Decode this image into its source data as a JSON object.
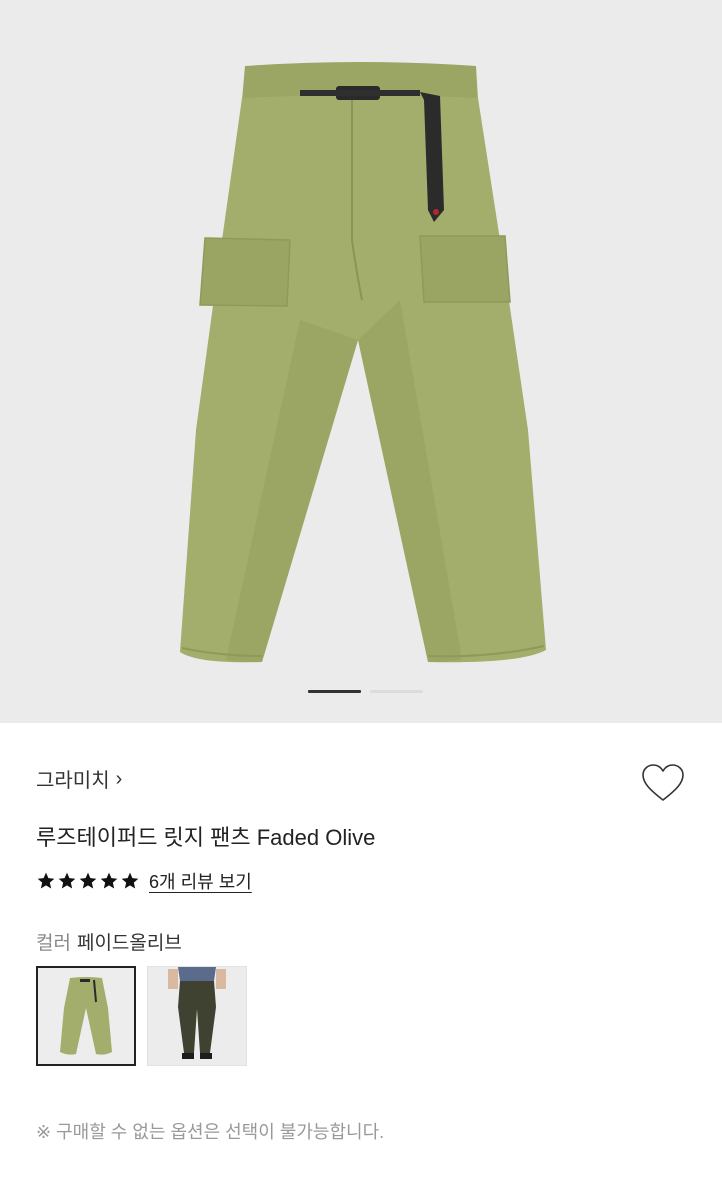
{
  "gallery": {
    "main_image": "pants-faded-olive-photo",
    "current_slide": 1,
    "total_slides": 2
  },
  "brand": {
    "name": "그라미치",
    "arrow": "›"
  },
  "wishlist": {
    "icon": "heart-outline-icon"
  },
  "product": {
    "title": "루즈테이퍼드 릿지 팬츠 Faded Olive"
  },
  "rating": {
    "stars": 5,
    "max_stars": 5,
    "review_link": "6개 리뷰 보기"
  },
  "color": {
    "label": "컬러",
    "selected": "페이드올리브",
    "options": [
      {
        "image": "faded-olive-pants-thumb",
        "selected": true
      },
      {
        "image": "dark-olive-pants-on-model-thumb",
        "selected": false
      }
    ]
  },
  "notice": "※ 구매할 수 없는 옵션은 선택이 불가능합니다.",
  "colors": {
    "olive": "#a3ad6c",
    "olive_shadow": "#8f9a5a",
    "hero_bg": "#ebebeb",
    "text_dark": "#222222",
    "text_muted": "#999999"
  }
}
